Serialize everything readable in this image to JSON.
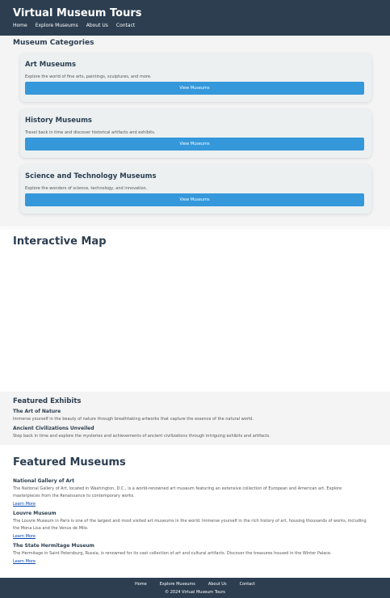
{
  "header": {
    "title": "Virtual Museum Tours",
    "nav": [
      "Home",
      "Explore Museums",
      "About Us",
      "Contact"
    ]
  },
  "categories": {
    "heading": "Museum Categories",
    "cards": [
      {
        "title": "Art Museums",
        "description": "Explore the world of fine arts, paintings, sculptures, and more.",
        "button": "View Museums"
      },
      {
        "title": "History Museums",
        "description": "Travel back in time and discover historical artifacts and exhibits.",
        "button": "View Museums"
      },
      {
        "title": "Science and Technology Museums",
        "description": "Explore the wonders of science, technology, and innovation.",
        "button": "View Museums"
      }
    ]
  },
  "map": {
    "heading": "Interactive Map"
  },
  "exhibits": {
    "heading": "Featured Exhibits",
    "items": [
      {
        "name": "The Art of Nature",
        "description": "Immerse yourself in the beauty of nature through breathtaking artworks that capture the essence of the natural world."
      },
      {
        "name": "Ancient Civilizations Unveiled",
        "description": "Step back in time and explore the mysteries and achievements of ancient civilizations through intriguing exhibits and artifacts."
      }
    ]
  },
  "museums": {
    "heading": "Featured Museums",
    "items": [
      {
        "name": "National Gallery of Art",
        "description": "The National Gallery of Art, located in Washington, D.C., is a world-renowned art museum featuring an extensive collection of European and American art. Explore masterpieces from the Renaissance to contemporary works.",
        "link": "Learn More"
      },
      {
        "name": "Louvre Museum",
        "description": "The Louvre Museum in Paris is one of the largest and most visited art museums in the world. Immerse yourself in the rich history of art, housing thousands of works, including the Mona Lisa and the Venus de Milo.",
        "link": "Learn More"
      },
      {
        "name": "The State Hermitage Museum",
        "description": "The Hermitage in Saint Petersburg, Russia, is renowned for its vast collection of art and cultural artifacts. Discover the treasures housed in the Winter Palace.",
        "link": "Learn More"
      }
    ]
  },
  "footer": {
    "nav": [
      "Home",
      "Explore Museums",
      "About Us",
      "Contact"
    ],
    "copyright": "© 2024 Virtual Museum Tours"
  },
  "colors": {
    "header_bg": "#2c3e50",
    "button_bg": "#3498db",
    "card_bg": "#ecf0f1",
    "section_bg": "#f4f4f4",
    "link": "#0645ad"
  }
}
